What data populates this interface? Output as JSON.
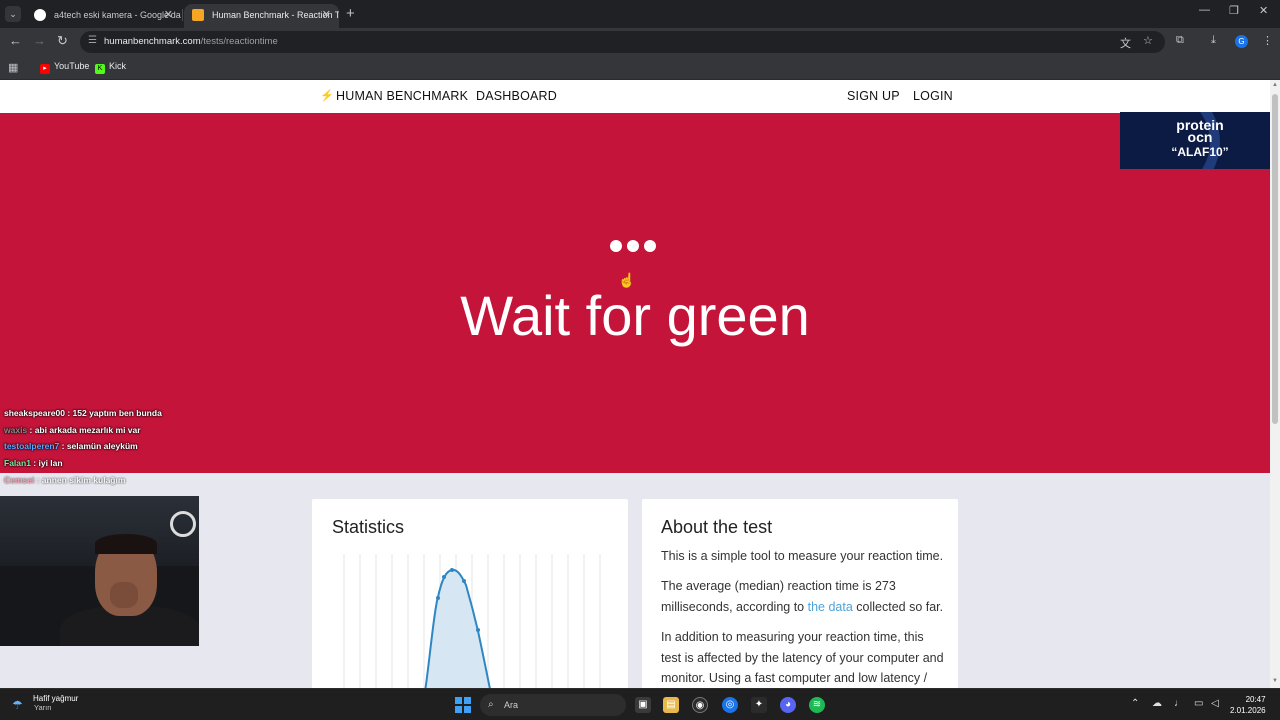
{
  "browser": {
    "tabs": [
      {
        "title": "a4tech eski kamera - Google'da",
        "active": false
      },
      {
        "title": "Human Benchmark - Reaction T",
        "active": true
      }
    ],
    "url_host": "humanbenchmark.com",
    "url_path": "/tests/reactiontime",
    "bookmarks": [
      "YouTube",
      "Kick"
    ]
  },
  "site": {
    "brand": "HUMAN BENCHMARK",
    "nav_dashboard": "DASHBOARD",
    "nav_signup": "SIGN UP",
    "nav_login": "LOGIN"
  },
  "hero": {
    "title": "Wait for green",
    "bg_color": "#c4143a"
  },
  "ad": {
    "brand_line1": "protein",
    "brand_line2": "ocn",
    "code": "“ALAF10”"
  },
  "stats": {
    "title": "Statistics"
  },
  "about": {
    "title": "About the test",
    "p1": "This is a simple tool to measure your reaction time.",
    "p2_a": "The average (median) reaction time is 273 milliseconds, according to ",
    "p2_link": "the data",
    "p2_b": " collected so far.",
    "p3": "In addition to measuring your reaction time, this test is affected by the latency of your computer and monitor. Using a fast computer and low latency /"
  },
  "chat": [
    {
      "user": "sheakspeare00",
      "msg": " : 152 yaptım ben bunda",
      "color": "#ffffff"
    },
    {
      "user": "waxis",
      "msg": " : abi arkada mezarlık mi var",
      "color": "#8a8a8a"
    },
    {
      "user": "testoalperen7",
      "msg": " : selamün aleyküm",
      "color": "#5aa8ff"
    },
    {
      "user": "Falan1",
      "msg": " : iyi lan",
      "color": "#7ee8a0"
    },
    {
      "user": "Cemsei",
      "msg": " : annen sikim kulağım",
      "color": "#ff6b8a"
    }
  ],
  "taskbar": {
    "weather": "Hafif yağmur",
    "weather_sub": "Yarın",
    "search_placeholder": "Ara",
    "time": "20:47",
    "date": "2.01.2026"
  }
}
